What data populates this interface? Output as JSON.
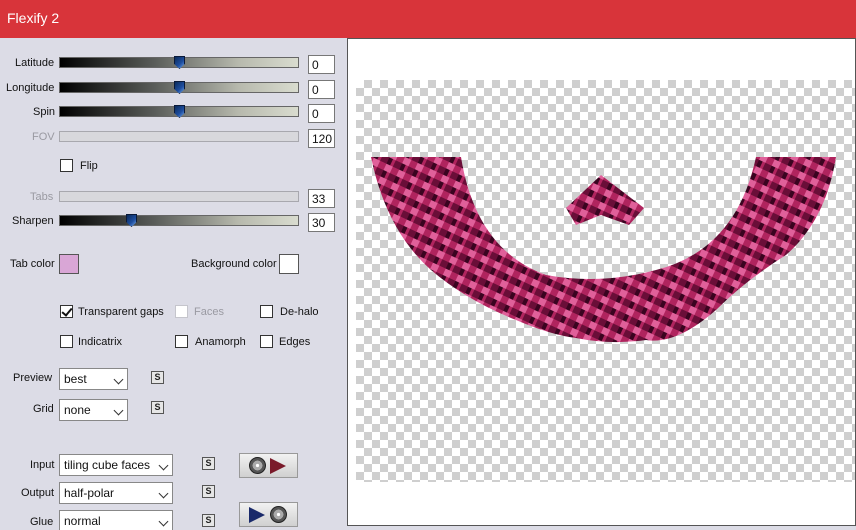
{
  "window": {
    "title": "Flexify 2"
  },
  "sliders": {
    "latitude": {
      "label": "Latitude",
      "value": "0",
      "fraction": 0.5
    },
    "longitude": {
      "label": "Longitude",
      "value": "0",
      "fraction": 0.5
    },
    "spin": {
      "label": "Spin",
      "value": "0",
      "fraction": 0.5
    },
    "fov": {
      "label": "FOV",
      "value": "120"
    },
    "tabs": {
      "label": "Tabs",
      "value": "33"
    },
    "sharpen": {
      "label": "Sharpen",
      "value": "30",
      "fraction": 0.3
    }
  },
  "flip": {
    "label": "Flip",
    "checked": false
  },
  "colors": {
    "tab_label": "Tab color",
    "tab_value": "#d9a6d6",
    "background_label": "Background color",
    "background_value": "#ffffff"
  },
  "options": {
    "transparent_gaps": {
      "label": "Transparent gaps",
      "checked": true
    },
    "faces": {
      "label": "Faces",
      "checked": false
    },
    "de_halo": {
      "label": "De-halo",
      "checked": false
    },
    "indicatrix": {
      "label": "Indicatrix",
      "checked": false
    },
    "anamorph": {
      "label": "Anamorph",
      "checked": false
    },
    "edges": {
      "label": "Edges",
      "checked": false
    }
  },
  "preview_select": {
    "label": "Preview",
    "value": "best"
  },
  "grid_select": {
    "label": "Grid",
    "value": "none"
  },
  "input_select": {
    "label": "Input",
    "value": "tiling cube faces"
  },
  "output_select": {
    "label": "Output",
    "value": "half-polar"
  },
  "glue_select": {
    "label": "Glue",
    "value": "normal"
  },
  "link_icon_glyph": "S",
  "accent": "#d8343a",
  "preview_shape_color": "#b0245e"
}
